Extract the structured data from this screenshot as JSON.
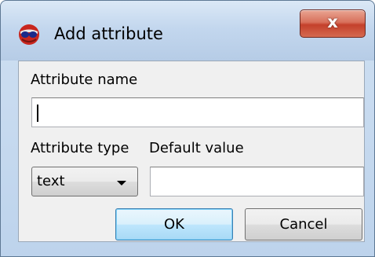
{
  "window": {
    "title": "Add attribute",
    "close_glyph": "x"
  },
  "form": {
    "name_label": "Attribute name",
    "name_value": "",
    "type_label": "Attribute type",
    "default_label": "Default value",
    "type_selected": "text",
    "default_value": ""
  },
  "buttons": {
    "ok": "OK",
    "cancel": "Cancel"
  },
  "icons": {
    "app": "app-logo-icon",
    "dropdown": "chevron-down-icon"
  },
  "colors": {
    "titlebar": "#c3d7ee",
    "close_button": "#c4402b",
    "client_bg": "#f0f0f0",
    "default_button": "#bee6fd"
  }
}
